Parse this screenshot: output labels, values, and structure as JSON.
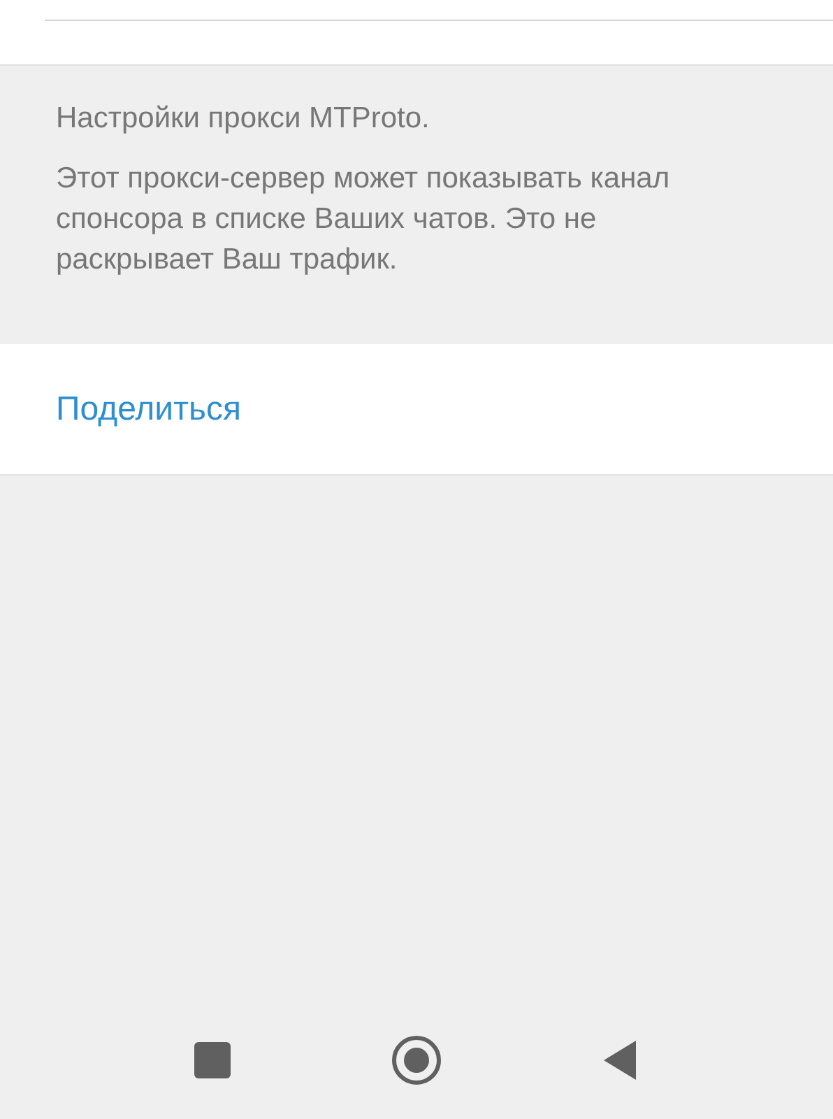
{
  "info": {
    "title": "Настройки прокси MTProto.",
    "lines": [
      "Этот прокси-сервер может показывать канал",
      "спонсора в списке Ваших чатов. Это не",
      "раскрывает Ваш трафик."
    ]
  },
  "share_button": {
    "label": "Поделиться"
  },
  "nav_bar": {
    "buttons": [
      {
        "kind": "recents"
      },
      {
        "kind": "home"
      },
      {
        "kind": "back"
      }
    ]
  }
}
